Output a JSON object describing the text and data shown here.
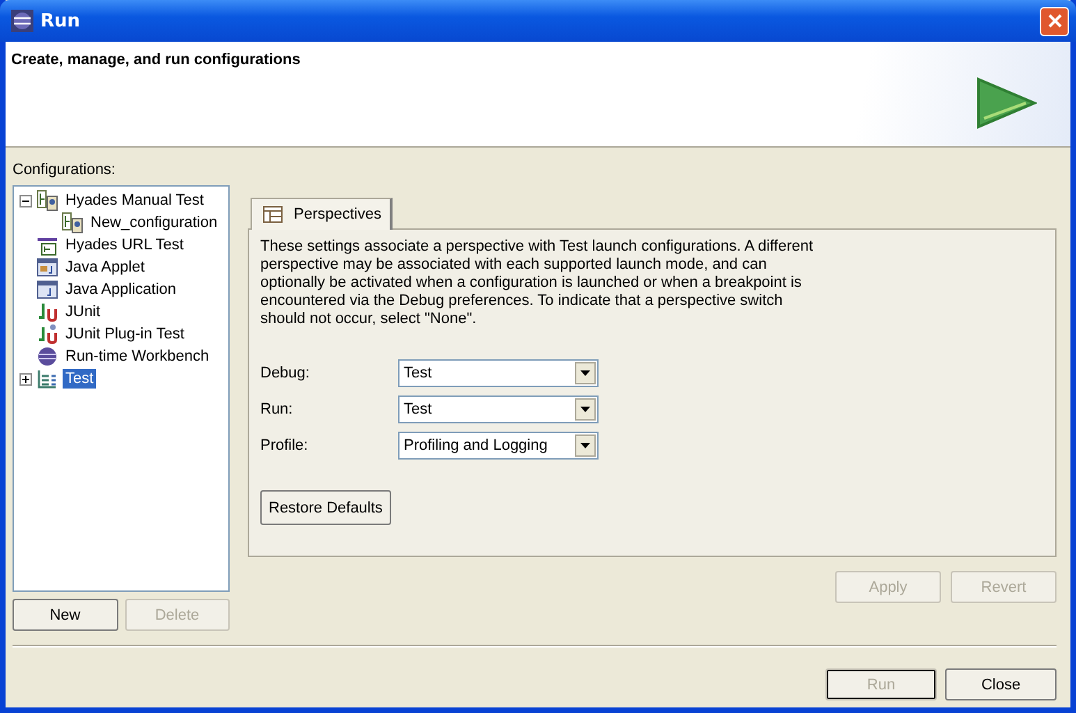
{
  "window": {
    "title": "Run"
  },
  "header": {
    "title": "Create, manage, and run configurations"
  },
  "configurations": {
    "label": "Configurations:",
    "items": [
      {
        "label": "Hyades Manual Test",
        "kind": "manual-test",
        "expanded": true,
        "selected": false,
        "children": [
          {
            "label": "New_configuration",
            "kind": "manual-test",
            "selected": false
          }
        ]
      },
      {
        "label": "Hyades URL Test",
        "kind": "url-test",
        "selected": false
      },
      {
        "label": "Java Applet",
        "kind": "applet",
        "selected": false
      },
      {
        "label": "Java Application",
        "kind": "application",
        "selected": false
      },
      {
        "label": "JUnit",
        "kind": "junit",
        "selected": false
      },
      {
        "label": "JUnit Plug-in Test",
        "kind": "plugin-test",
        "selected": false
      },
      {
        "label": "Run-time Workbench",
        "kind": "workbench",
        "selected": false
      },
      {
        "label": "Test",
        "kind": "test",
        "expanded": false,
        "selected": true
      }
    ],
    "buttons": [
      {
        "label": "New",
        "disabled": false
      },
      {
        "label": "Delete",
        "disabled": true
      }
    ]
  },
  "tabs": [
    {
      "label": "Perspectives",
      "selected": true
    }
  ],
  "perspectives": {
    "description": "These settings associate a perspective with Test launch configurations. A different perspective may be associated with each supported launch mode, and can optionally be activated when a configuration is launched or when a breakpoint is encountered via the Debug preferences. To indicate that a perspective switch should not occur, select \"None\".",
    "fields": [
      {
        "label": "Debug:",
        "value": "Test"
      },
      {
        "label": "Run:",
        "value": "Test"
      },
      {
        "label": "Profile:",
        "value": "Profiling and Logging"
      }
    ],
    "restore_button": "Restore Defaults"
  },
  "edit_buttons": [
    {
      "label": "Apply",
      "disabled": true
    },
    {
      "label": "Revert",
      "disabled": true
    }
  ],
  "dialog_buttons": [
    {
      "label": "Run",
      "disabled": true,
      "default": true
    },
    {
      "label": "Close",
      "disabled": false,
      "default": false
    }
  ]
}
